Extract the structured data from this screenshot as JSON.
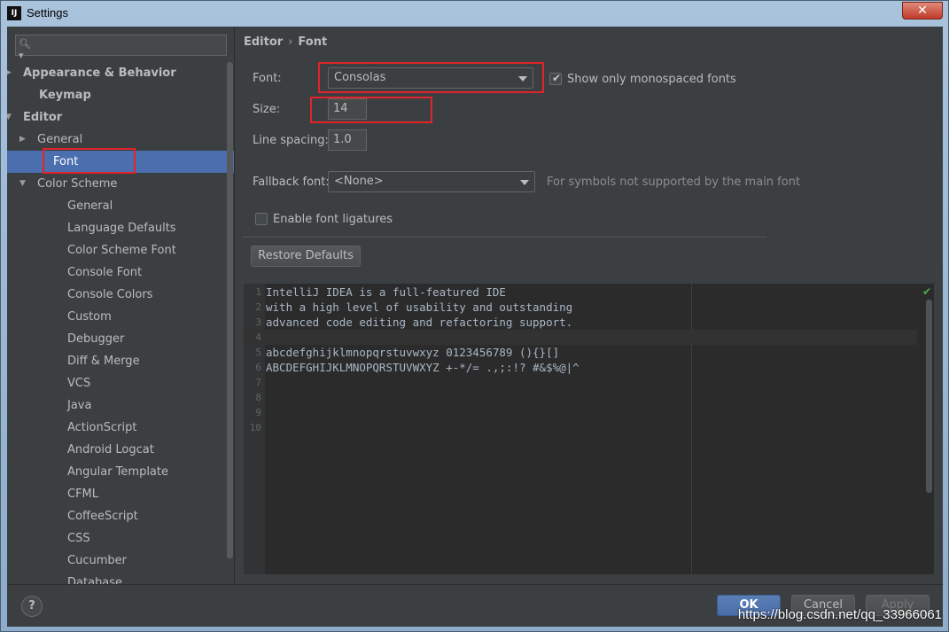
{
  "window": {
    "title": "Settings",
    "app_icon": "IJ",
    "close_glyph": "✕"
  },
  "search": {
    "placeholder": ""
  },
  "sidebar": {
    "items": [
      {
        "label": "Appearance & Behavior",
        "arrow": "▶"
      },
      {
        "label": "Keymap"
      },
      {
        "label": "Editor",
        "arrow": "▼"
      },
      {
        "label": "General",
        "arrow": "▶"
      },
      {
        "label": "Font",
        "selected": true
      },
      {
        "label": "Color Scheme",
        "arrow": "▼"
      },
      {
        "label": "General"
      },
      {
        "label": "Language Defaults"
      },
      {
        "label": "Color Scheme Font"
      },
      {
        "label": "Console Font"
      },
      {
        "label": "Console Colors"
      },
      {
        "label": "Custom"
      },
      {
        "label": "Debugger"
      },
      {
        "label": "Diff & Merge"
      },
      {
        "label": "VCS"
      },
      {
        "label": "Java"
      },
      {
        "label": "ActionScript"
      },
      {
        "label": "Android Logcat"
      },
      {
        "label": "Angular Template"
      },
      {
        "label": "CFML"
      },
      {
        "label": "CoffeeScript"
      },
      {
        "label": "CSS"
      },
      {
        "label": "Cucumber"
      },
      {
        "label": "Database"
      }
    ]
  },
  "breadcrumb": {
    "parent": "Editor",
    "sep": "›",
    "current": "Font"
  },
  "form": {
    "font_label": "Font:",
    "font_value": "Consolas",
    "monospaced_label": "Show only monospaced fonts",
    "monospaced_checked": true,
    "size_label": "Size:",
    "size_value": "14",
    "line_spacing_label": "Line spacing:",
    "line_spacing_value": "1.0",
    "fallback_label": "Fallback font:",
    "fallback_value": "<None>",
    "fallback_hint": "For symbols not supported by the main font",
    "ligatures_label": "Enable font ligatures",
    "ligatures_checked": false,
    "restore_label": "Restore Defaults"
  },
  "preview": {
    "lines": [
      {
        "n": "1",
        "text": "IntelliJ IDEA is a full-featured IDE"
      },
      {
        "n": "2",
        "text": "with a high level of usability and outstanding"
      },
      {
        "n": "3",
        "text": "advanced code editing and refactoring support."
      },
      {
        "n": "4",
        "text": ""
      },
      {
        "n": "5",
        "text": "abcdefghijklmnopqrstuvwxyz 0123456789 (){}[]"
      },
      {
        "n": "6",
        "text": "ABCDEFGHIJKLMNOPQRSTUVWXYZ +-*/= .,;:!? #&$%@|^"
      },
      {
        "n": "7",
        "text": ""
      },
      {
        "n": "8",
        "text": ""
      },
      {
        "n": "9",
        "text": ""
      },
      {
        "n": "10",
        "text": ""
      }
    ],
    "current_line": 4
  },
  "buttons": {
    "help": "?",
    "ok": "OK",
    "cancel": "Cancel",
    "apply": "Apply"
  },
  "watermark": "https://blog.csdn.net/qq_33966061",
  "colors": {
    "accent": "#4b6eaf",
    "highlight": "#e0242a",
    "background": "#3c3f41"
  }
}
